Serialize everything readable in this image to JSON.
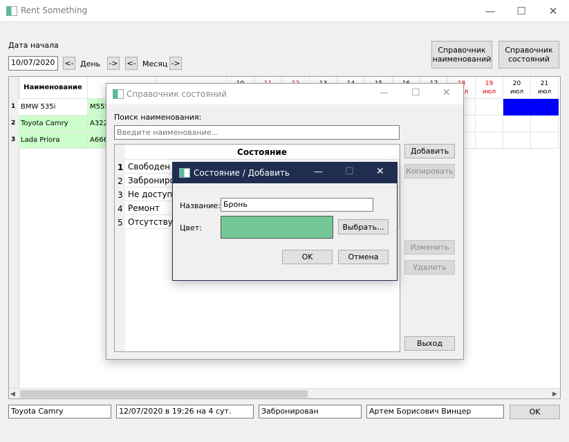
{
  "app": {
    "title": "Rent Something"
  },
  "controls": {
    "start_label": "Дата начала",
    "start_date": "10/07/2020",
    "day_prev": "<-",
    "day_label": "День",
    "day_next": "->",
    "month_prev": "<-",
    "month_label": "Месяц",
    "month_next": "->",
    "names_dir_btn": "Справочник наименований",
    "states_dir_btn": "Справочник состояний"
  },
  "table": {
    "name_header": "Наименование",
    "rows": [
      {
        "num": "1",
        "name": "BMW 535i",
        "plate": "M555"
      },
      {
        "num": "2",
        "name": "Toyota Camry",
        "plate": "A322E"
      },
      {
        "num": "3",
        "name": "Lada Priora",
        "plate": "A666P"
      }
    ],
    "days": [
      {
        "day": "10",
        "month": "",
        "red": false
      },
      {
        "day": "11",
        "month": "",
        "red": true
      },
      {
        "day": "12",
        "month": "",
        "red": true
      },
      {
        "day": "13",
        "month": "",
        "red": false
      },
      {
        "day": "14",
        "month": "",
        "red": false
      },
      {
        "day": "15",
        "month": "",
        "red": false
      },
      {
        "day": "16",
        "month": "",
        "red": false
      },
      {
        "day": "17",
        "month": "",
        "red": false
      },
      {
        "day": "18",
        "month": "июл",
        "red": true
      },
      {
        "day": "19",
        "month": "июл",
        "red": true
      },
      {
        "day": "20",
        "month": "июл",
        "red": false
      },
      {
        "day": "21",
        "month": "июл",
        "red": false
      }
    ]
  },
  "status": {
    "item": "Toyota Camry",
    "period": "12/07/2020 в 19:26 на 4 сут.",
    "state": "Забронирован",
    "person": "Артем Борисович Винцер",
    "ok_label": "OK"
  },
  "states_dialog": {
    "title": "Справочник состояний",
    "search_label": "Поиск наименования:",
    "search_placeholder": "Введите наименование...",
    "column_header": "Состояние",
    "items": [
      {
        "num": "1",
        "label": "Свободен"
      },
      {
        "num": "2",
        "label": "Забронирован"
      },
      {
        "num": "3",
        "label": "Не доступен"
      },
      {
        "num": "4",
        "label": "Ремонт"
      },
      {
        "num": "5",
        "label": "Отсутствует"
      }
    ],
    "add_label": "Добавить",
    "copy_label": "Копировать",
    "edit_label": "Изменить",
    "delete_label": "Удалить",
    "exit_label": "Выход"
  },
  "add_dialog": {
    "title": "Состояние / Добавить",
    "name_label": "Название:",
    "name_value": "Бронь",
    "color_label": "Цвет:",
    "color_value": "#74c898",
    "choose_label": "Выбрать...",
    "ok_label": "OK",
    "cancel_label": "Отмена"
  },
  "colors": {
    "row_green": "#ccffcc",
    "booking_blue": "#0000ff",
    "accent_red": "#e00000"
  }
}
